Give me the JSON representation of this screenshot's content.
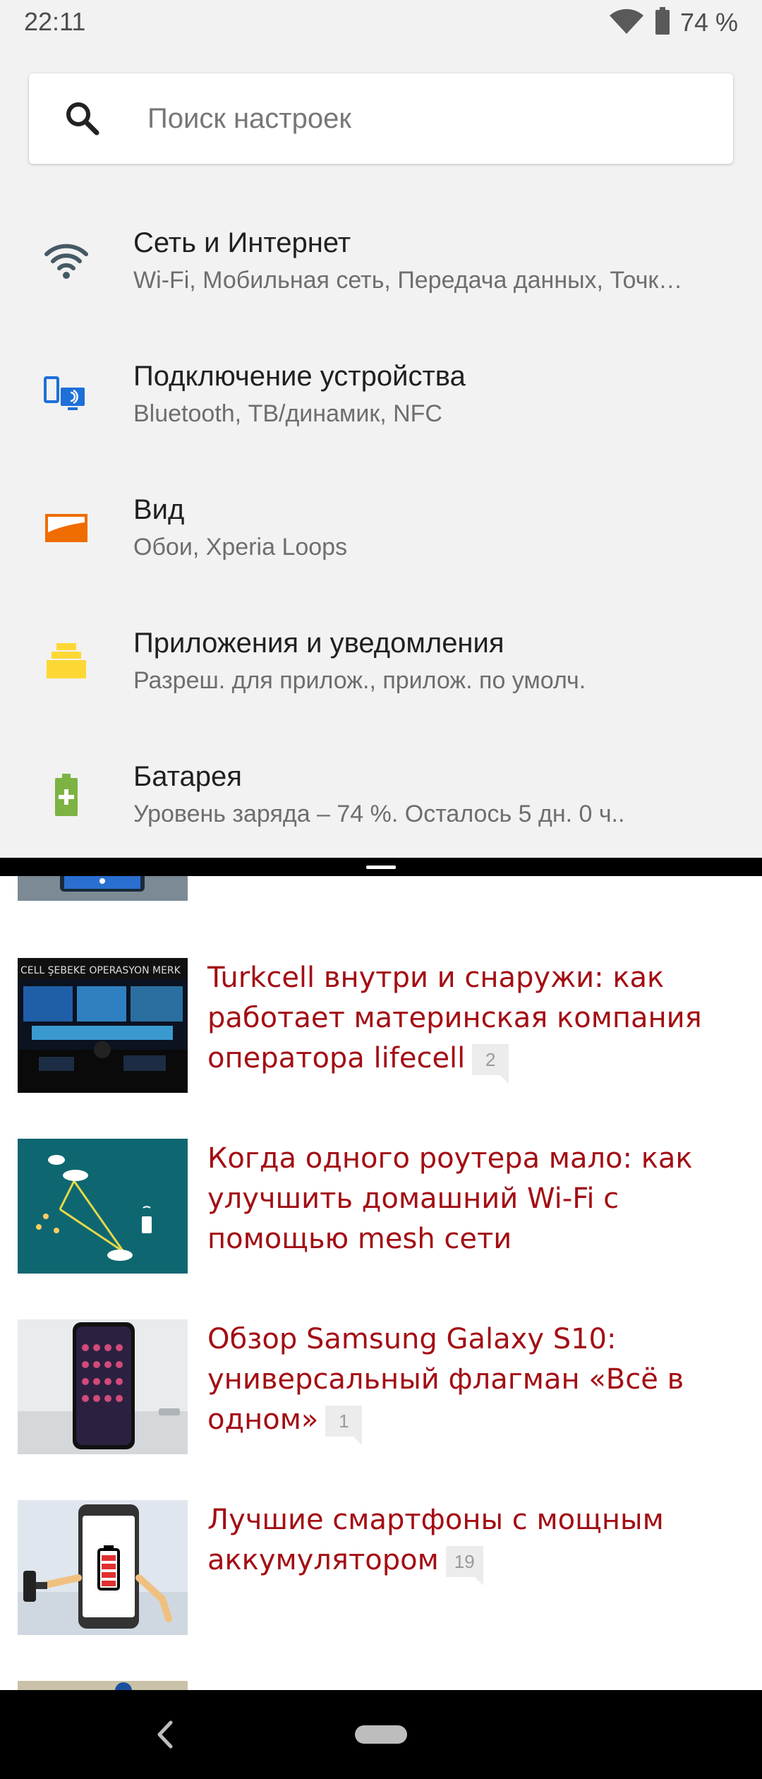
{
  "status_bar": {
    "time": "22:11",
    "battery_text": "74 %",
    "icons": [
      "wifi-icon",
      "battery-icon"
    ]
  },
  "search": {
    "placeholder": "Поиск настроек",
    "value": ""
  },
  "settings": [
    {
      "icon": "wifi-icon",
      "title": "Сеть и Интернет",
      "summary": "Wi-Fi, Мобильная сеть, Передача данных, Точк…"
    },
    {
      "icon": "connected-devices-icon",
      "title": "Подключение устройства",
      "summary": "Bluetooth, ТВ/динамик, NFC"
    },
    {
      "icon": "display-icon",
      "title": "Вид",
      "summary": "Обои, Xperia Loops"
    },
    {
      "icon": "apps-icon",
      "title": "Приложения и уведомления",
      "summary": "Разреш. для прилож., прилож. по умолч."
    },
    {
      "icon": "battery-plus-icon",
      "title": "Батарея",
      "summary": "Уровень заряда – 74 %. Осталось 5 дн. 0 ч.."
    }
  ],
  "articles": [
    {
      "title": "Turkcell внутри и снаружи: как работает материнская компания оператора lifecell",
      "comments": "2"
    },
    {
      "title": "Когда одного роутера мало: как улучшить домашний Wi-Fi с помощью mesh сети",
      "comments": ""
    },
    {
      "title": "Обзор Samsung Galaxy S10: универсальный флагман «Всё в одном»",
      "comments": "1"
    },
    {
      "title": "Лучшие смартфоны с мощным аккумулятором",
      "comments": "19"
    }
  ],
  "colors": {
    "settings_background": "#f2f2f2",
    "article_title": "#a30e14",
    "wifi_icon": "#455a64",
    "devices_icon": "#1e6fd9",
    "display_icon": "#ef6c00",
    "apps_icon": "#fdd835",
    "battery_icon": "#7cb342"
  },
  "nav_bar": {
    "icons": [
      "back-icon",
      "home-pill-icon"
    ]
  }
}
